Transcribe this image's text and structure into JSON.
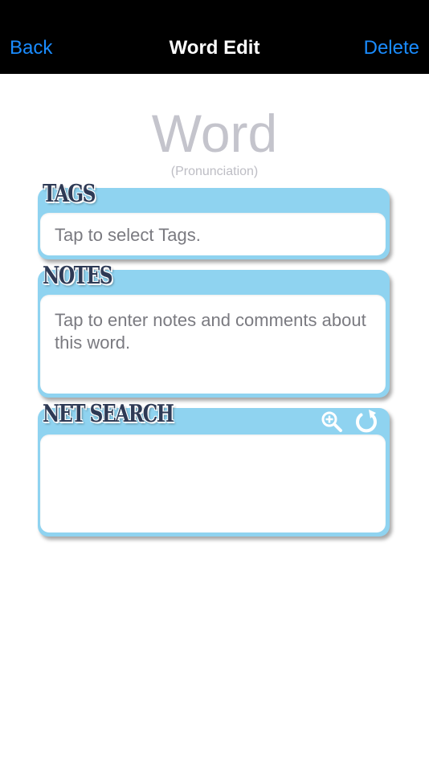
{
  "navbar": {
    "back_label": "Back",
    "title": "Word Edit",
    "delete_label": "Delete",
    "accent_color": "#1a8cff"
  },
  "word": {
    "text": "Word",
    "pronunciation": "(Pronunciation)"
  },
  "tags": {
    "title": "TAGS",
    "placeholder": "Tap to select Tags."
  },
  "notes": {
    "title": "NOTES",
    "placeholder": "Tap to enter notes and comments about this word."
  },
  "net_search": {
    "title": "NET SEARCH",
    "icons": [
      "zoom-in-icon",
      "refresh-icon"
    ]
  },
  "colors": {
    "card_header": "#8fd3f0",
    "navbar_bg": "#000000"
  }
}
